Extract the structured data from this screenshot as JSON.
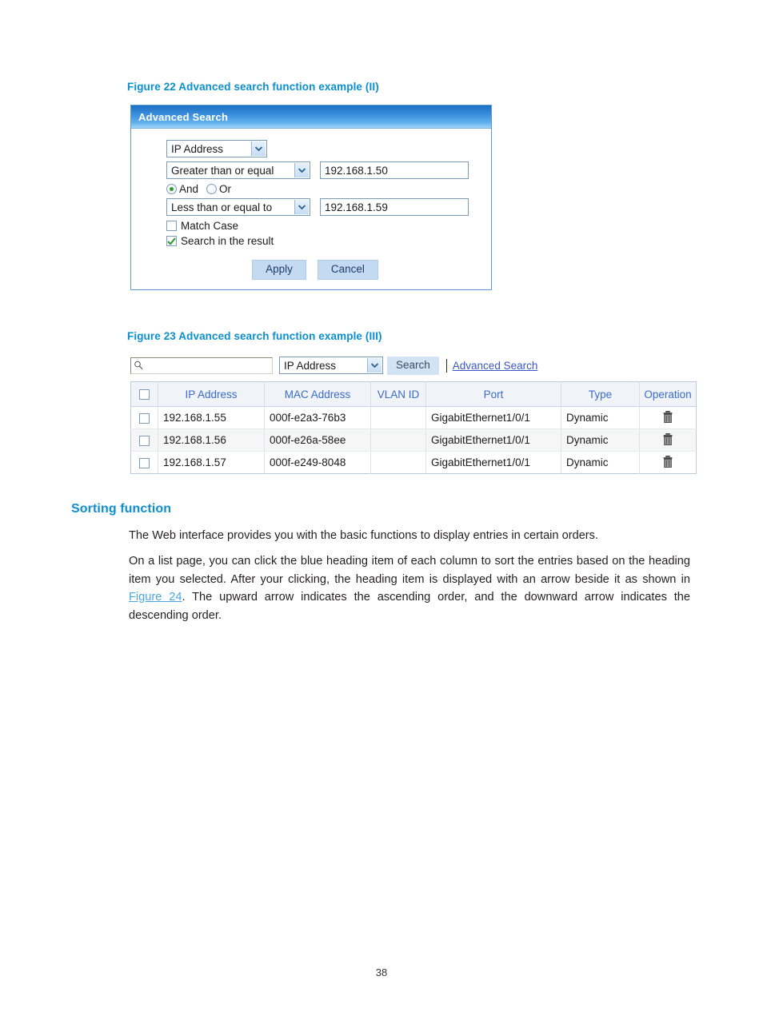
{
  "page": {
    "number": "38"
  },
  "figure22": {
    "caption": "Figure 22 Advanced search function example (II)",
    "dialog": {
      "title": "Advanced Search",
      "field_select": {
        "value": "IP Address",
        "icon": "chevron-down-icon"
      },
      "condition1": {
        "operator": "Greater than or equal",
        "value": "192.168.1.50"
      },
      "logic": {
        "and_label": "And",
        "or_label": "Or",
        "selected": "And"
      },
      "condition2": {
        "operator": "Less than or equal to",
        "value": "192.168.1.59"
      },
      "match_case": {
        "label": "Match Case",
        "checked": false
      },
      "search_in_result": {
        "label": "Search in the result",
        "checked": true
      },
      "apply_label": "Apply",
      "cancel_label": "Cancel"
    }
  },
  "figure23": {
    "caption": "Figure 23 Advanced search function example (III)",
    "toolbar": {
      "search_input_value": "",
      "search_input_placeholder": "",
      "search_icon": "magnifier-icon",
      "field_select_value": "IP Address",
      "search_button_label": "Search",
      "advanced_search_link": "Advanced Search"
    },
    "table": {
      "columns": [
        "",
        "IP Address",
        "MAC Address",
        "VLAN ID",
        "Port",
        "Type",
        "Operation"
      ],
      "rows": [
        {
          "ip": "192.168.1.55",
          "mac": "000f-e2a3-76b3",
          "vlan": "",
          "port": "GigabitEthernet1/0/1",
          "type": "Dynamic",
          "operation_icon": "trash-icon"
        },
        {
          "ip": "192.168.1.56",
          "mac": "000f-e26a-58ee",
          "vlan": "",
          "port": "GigabitEthernet1/0/1",
          "type": "Dynamic",
          "operation_icon": "trash-icon"
        },
        {
          "ip": "192.168.1.57",
          "mac": "000f-e249-8048",
          "vlan": "",
          "port": "GigabitEthernet1/0/1",
          "type": "Dynamic",
          "operation_icon": "trash-icon"
        }
      ]
    }
  },
  "sorting_section": {
    "heading": "Sorting function",
    "paragraph1": "The Web interface provides you with the basic functions to display entries in certain orders.",
    "paragraph2_part1": "On a list page, you can click the blue heading item of each column to sort the entries based on the heading item you selected. After your clicking, the heading item is displayed with an arrow beside it as shown in ",
    "paragraph2_link": "Figure 24",
    "paragraph2_part2": ". The upward arrow indicates the ascending order, and the downward arrow indicates the descending order."
  },
  "colors": {
    "caption_blue": "#0c8fce",
    "heading_blue": "#0c8fce",
    "link_blue": "#4aa7dd",
    "table_header_blue": "#3b6ccc",
    "ui_link_blue": "#3b56c4",
    "dialog_border": "#5b9bd5"
  }
}
